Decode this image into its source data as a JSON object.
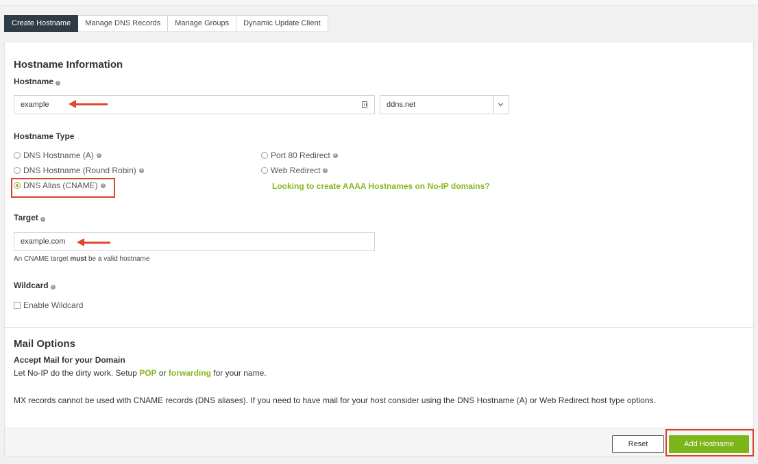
{
  "tabs": [
    {
      "label": "Create Hostname",
      "active": true
    },
    {
      "label": "Manage DNS Records"
    },
    {
      "label": "Manage Groups"
    },
    {
      "label": "Dynamic Update Client"
    }
  ],
  "hostname_info": {
    "title": "Hostname Information",
    "hostname_label": "Hostname",
    "hostname_value": "example",
    "domain_value": "ddns.net"
  },
  "hostname_type": {
    "label": "Hostname Type",
    "options": [
      {
        "label": "DNS Hostname (A)",
        "checked": false
      },
      {
        "label": "DNS Hostname (Round Robin)",
        "checked": false
      },
      {
        "label": "DNS Alias (CNAME)",
        "checked": true
      },
      {
        "label": "Port 80 Redirect",
        "checked": false
      },
      {
        "label": "Web Redirect",
        "checked": false
      }
    ],
    "aaaa_link": "Looking to create AAAA Hostnames on No-IP domains?"
  },
  "target": {
    "label": "Target",
    "value": "example.com",
    "help_prefix": "An CNAME target ",
    "help_bold": "must",
    "help_suffix": " be a valid hostname"
  },
  "wildcard": {
    "label": "Wildcard",
    "checkbox_label": "Enable Wildcard",
    "checked": false
  },
  "mail": {
    "title": "Mail Options",
    "subtitle": "Accept Mail for your Domain",
    "line_prefix": "Let No-IP do the dirty work. Setup ",
    "pop_link": "POP",
    "or_text": " or ",
    "forwarding_link": "forwarding",
    "line_suffix": " for your name.",
    "note": "MX records cannot be used with CNAME records (DNS aliases). If you need to have mail for your host consider using the DNS Hostname (A) or Web Redirect host type options."
  },
  "buttons": {
    "reset": "Reset",
    "add": "Add Hostname"
  },
  "icons": {
    "info": "info-icon",
    "field": "contact-card-icon",
    "dropdown": "chevron-down-icon",
    "arrow": "red-arrow-annotation"
  },
  "colors": {
    "accent_green": "#7cb518",
    "tab_active": "#2f3b45",
    "annotation_red": "#d9412b"
  }
}
